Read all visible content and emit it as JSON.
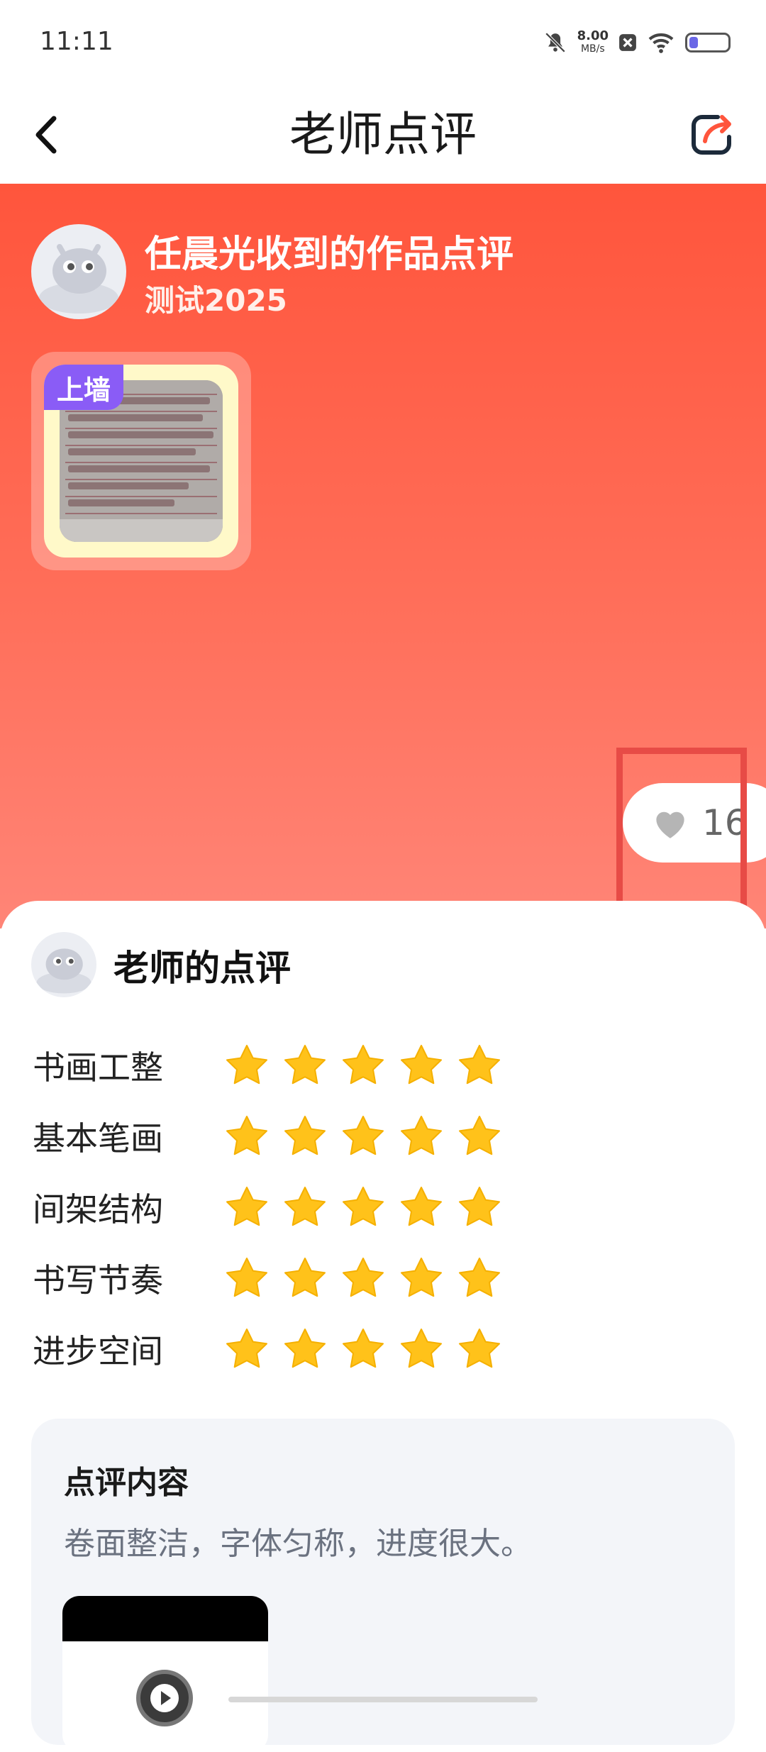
{
  "status_bar": {
    "time": "11:11",
    "net_speed": "8.00",
    "net_unit": "MB/s",
    "icons": [
      "mute-bell-icon",
      "close-box-icon",
      "wifi-icon",
      "battery-icon"
    ]
  },
  "nav": {
    "title": "老师点评",
    "back_icon": "chevron-left-icon",
    "share_icon": "share-icon"
  },
  "hero": {
    "title": "任晨光收到的作品点评",
    "subtitle": "测试2025",
    "badge": "上墙",
    "likes": "16",
    "gradient": [
      "#ff553c",
      "#ff8577"
    ]
  },
  "review": {
    "heading": "老师的点评",
    "ratings": [
      {
        "label": "书画工整",
        "stars": 5,
        "max": 5
      },
      {
        "label": "基本笔画",
        "stars": 5,
        "max": 5
      },
      {
        "label": "间架结构",
        "stars": 5,
        "max": 5
      },
      {
        "label": "书写节奏",
        "stars": 5,
        "max": 5
      },
      {
        "label": "进步空间",
        "stars": 5,
        "max": 5
      }
    ],
    "star_color": "#ffc21a"
  },
  "comment": {
    "title": "点评内容",
    "text": "卷面整洁，字体匀称，进度很大。"
  },
  "colors": {
    "accent_red": "#ff553c",
    "badge_purple": "#8a5cf6",
    "highlight_red": "#e74b46"
  }
}
